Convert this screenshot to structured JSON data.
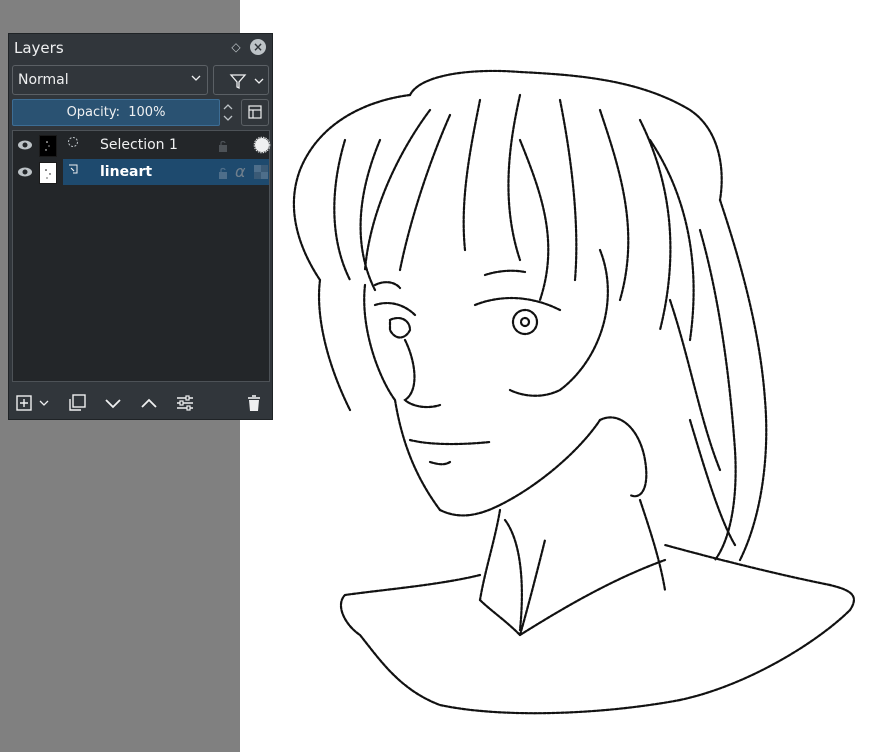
{
  "docker": {
    "title": "Layers",
    "blend_mode": "Normal",
    "opacity_label": "Opacity:",
    "opacity_value": "100%"
  },
  "layers": [
    {
      "name": "Selection 1",
      "type": "selection-mask",
      "visible": true,
      "selected": false
    },
    {
      "name": "lineart",
      "type": "paint-layer",
      "visible": true,
      "selected": true
    }
  ],
  "icons": {
    "float": "float-icon",
    "close": "close-icon",
    "filter": "filter-icon",
    "add": "add-layer-icon",
    "duplicate": "duplicate-layer-icon",
    "move_down": "move-down-icon",
    "move_up": "move-up-icon",
    "properties": "properties-icon",
    "delete": "trash-icon"
  },
  "colors": {
    "panel_bg": "#31363b",
    "list_bg": "#232629",
    "selection": "#1e4a6e",
    "opacity_fill": "#2a5272",
    "canvas": "#ffffff",
    "workspace": "#808080"
  }
}
